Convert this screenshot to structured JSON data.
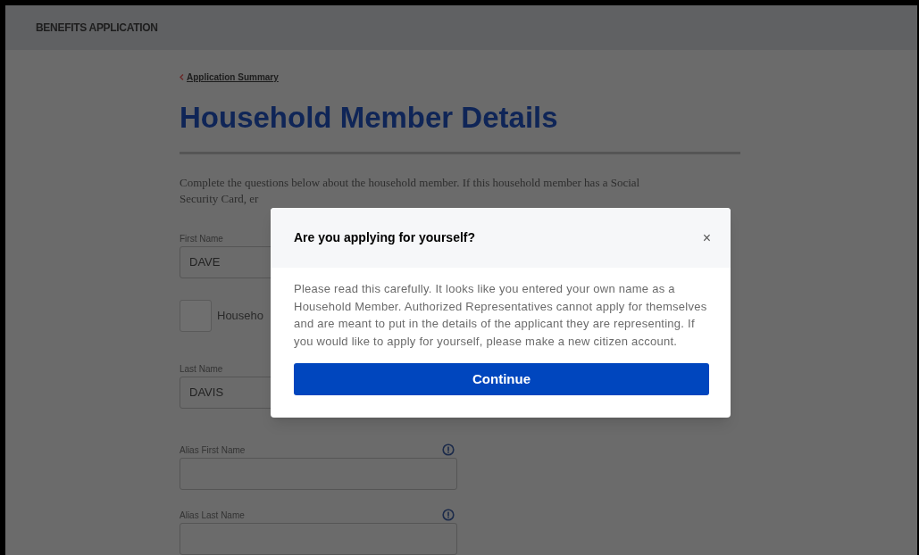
{
  "header": {
    "title": "BENEFITS APPLICATION"
  },
  "back_link": {
    "label": "Application Summary"
  },
  "page_title": "Household Member Details",
  "intro_lines": [
    "Complete the questions below about the household member. If this household member has a Social",
    "Security Card, er"
  ],
  "fields": [
    {
      "kind": "text",
      "label": "First Name",
      "value": "DAVE"
    },
    {
      "kind": "checkbox",
      "label": "Househo",
      "checked": false
    },
    {
      "kind": "text",
      "label": "Last Name",
      "value": "DAVIS"
    },
    {
      "kind": "text",
      "label": "Alias First Name",
      "info": true
    },
    {
      "kind": "text",
      "label": "Alias Last Name",
      "info": true
    }
  ],
  "dialog": {
    "title": "Are you applying for yourself?",
    "close": "×",
    "message": "Please read this carefully. It looks like you entered your own name as a Household Member. Authorized Representatives cannot apply for themselves and are meant to put in the details of the applicant they are representing. If you would like to apply for yourself, please make a new citizen account.",
    "button": "Continue"
  }
}
